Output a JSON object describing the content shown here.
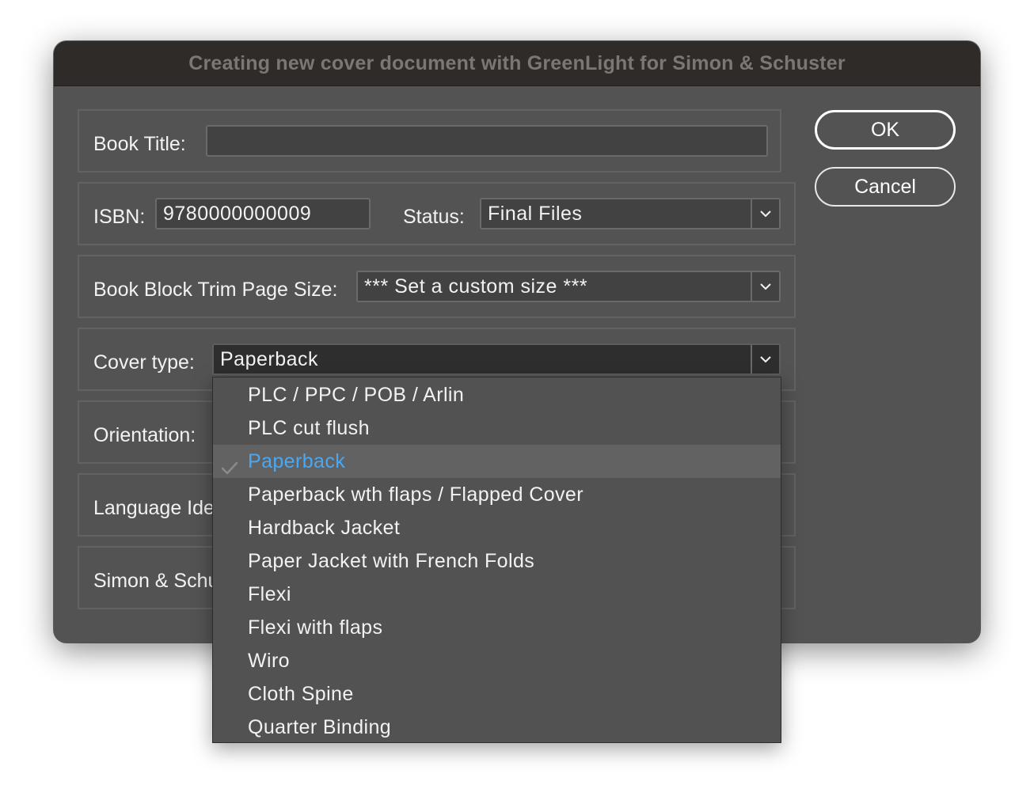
{
  "window": {
    "title": "Creating new cover document with GreenLight for Simon & Schuster"
  },
  "form": {
    "book_title_label": "Book Title:",
    "book_title_value": "",
    "isbn_label": "ISBN:",
    "isbn_value": "9780000000009",
    "status_label": "Status:",
    "status_value": "Final Files",
    "trim_label": "Book Block Trim Page Size:",
    "trim_value": "*** Set a custom size ***",
    "cover_type_label": "Cover type:",
    "cover_type_value": "Paperback",
    "orientation_label": "Orientation:",
    "language_label": "Language Ide",
    "imprint_label": "Simon & Schu"
  },
  "buttons": {
    "ok": "OK",
    "cancel": "Cancel"
  },
  "dropdown": {
    "selected": "Paperback",
    "options": [
      "PLC / PPC / POB / Arlin",
      "PLC cut flush",
      "Paperback",
      "Paperback wth flaps / Flapped Cover",
      "Hardback Jacket",
      "Paper Jacket with French Folds",
      "Flexi",
      "Flexi with flaps",
      "Wiro",
      "Cloth Spine",
      "Quarter Binding"
    ]
  },
  "colors": {
    "selected_text": "#4aa8f2",
    "window_bg": "#535353",
    "titlebar_bg": "#2f2b29"
  }
}
